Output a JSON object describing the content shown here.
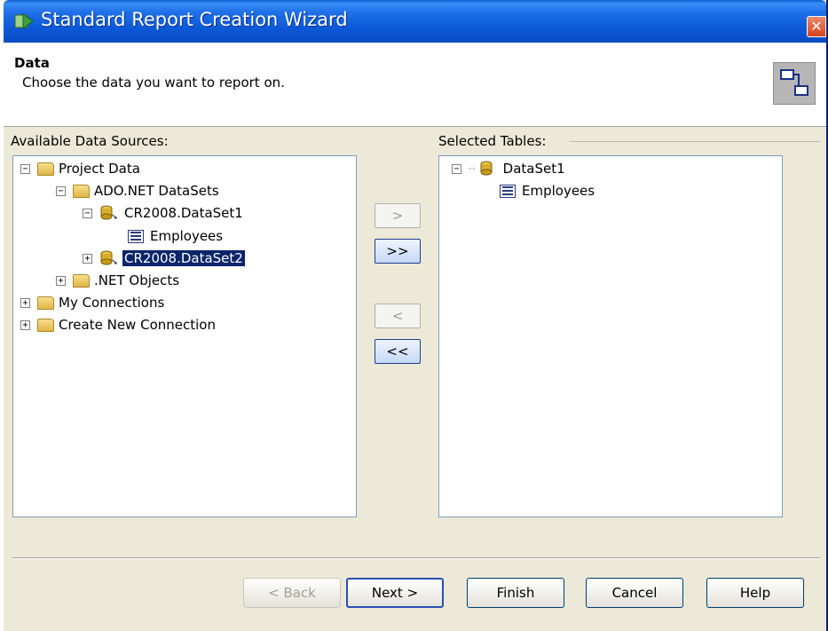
{
  "window": {
    "title": "Standard Report Creation Wizard",
    "close_glyph": "✕",
    "accent": "#0a4cc2"
  },
  "header": {
    "title": "Data",
    "subtitle": "Choose the data you want to report on.",
    "icon": "link-tables-icon"
  },
  "left_panel": {
    "label": "Available Data Sources:",
    "items": [
      {
        "label": "Project Data",
        "icon": "folder-icon",
        "expander": "−"
      },
      {
        "label": "ADO.NET DataSets",
        "icon": "folder-icon",
        "expander": "−"
      },
      {
        "label": "CR2008.DataSet1",
        "icon": "dataset-icon",
        "expander": "−"
      },
      {
        "label": "Employees",
        "icon": "table-icon",
        "expander": ""
      },
      {
        "label": "CR2008.DataSet2",
        "icon": "dataset-icon",
        "expander": "+",
        "selected": true
      },
      {
        "label": ".NET Objects",
        "icon": "folder-icon",
        "expander": "+"
      },
      {
        "label": "My Connections",
        "icon": "folder-icon",
        "expander": "+"
      },
      {
        "label": "Create New Connection",
        "icon": "folder-icon",
        "expander": "+"
      }
    ]
  },
  "right_panel": {
    "label": "Selected Tables:",
    "items": [
      {
        "label": "DataSet1",
        "icon": "dataset-icon",
        "expander": "−"
      },
      {
        "label": "Employees",
        "icon": "table-icon",
        "expander": ""
      }
    ]
  },
  "move_buttons": {
    "add_one": ">",
    "add_all": ">>",
    "remove_one": "<",
    "remove_all": "<<"
  },
  "footer_buttons": {
    "back": "< Back",
    "next": "Next >",
    "finish": "Finish",
    "cancel": "Cancel",
    "help": "Help"
  }
}
